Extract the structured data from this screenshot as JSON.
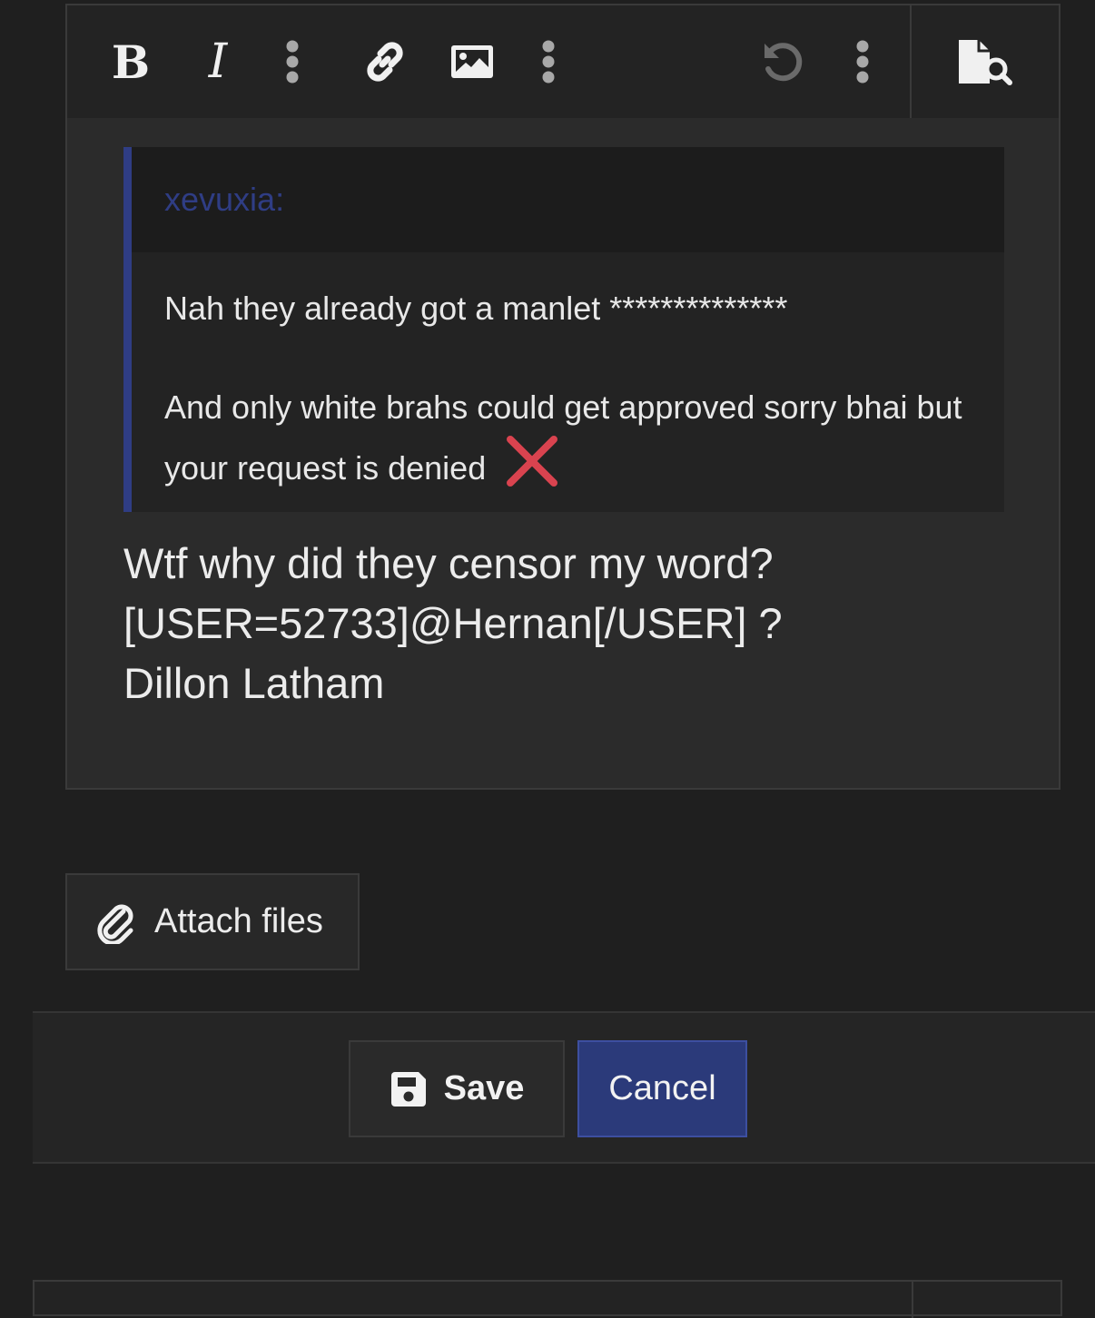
{
  "toolbar": {
    "bold_icon": "bold-icon",
    "italic_icon": "italic-icon",
    "more_icon": "vertical-dots-icon",
    "link_icon": "link-icon",
    "image_icon": "image-icon",
    "undo_icon": "undo-icon",
    "preview_icon": "document-search-icon"
  },
  "quote": {
    "author": "xevuxia:",
    "line1": "Nah they already got a manlet **************",
    "line2": "And only white brahs could get approved sorry bhai but your request is denied",
    "emoji": "cross-mark-icon"
  },
  "message": {
    "lines": [
      "Wtf why did they censor my word?",
      "[USER=52733]@Hernan[/USER] ?",
      "Dillon Latham"
    ]
  },
  "attach": {
    "label": "Attach files",
    "icon": "paperclip-icon"
  },
  "actions": {
    "save_label": "Save",
    "save_icon": "floppy-disk-icon",
    "cancel_label": "Cancel"
  },
  "colors": {
    "accent": "#2f3d84",
    "cancel_bg": "#2b3a7a",
    "cross": "#d9434f"
  }
}
